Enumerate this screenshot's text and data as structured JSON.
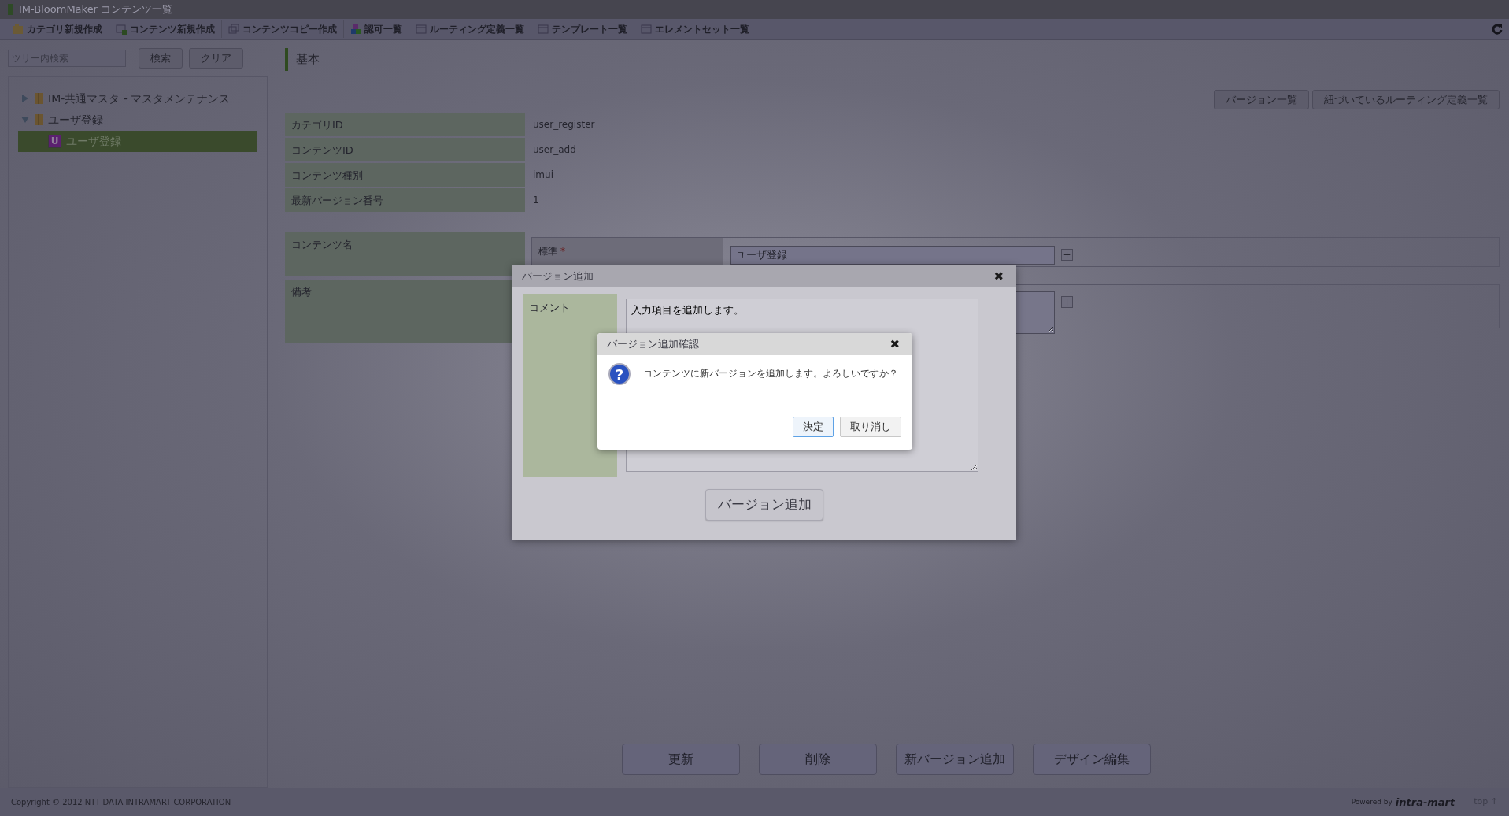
{
  "window": {
    "title": "IM-BloomMaker コンテンツ一覧"
  },
  "toolbar": [
    {
      "label": "カテゴリ新規作成",
      "kind": "folder"
    },
    {
      "label": "コンテンツ新規作成",
      "kind": "new"
    },
    {
      "label": "コンテンツコピー作成",
      "kind": "copy"
    },
    {
      "label": "認可一覧",
      "kind": "blocks"
    },
    {
      "label": "ルーティング定義一覧",
      "kind": "table"
    },
    {
      "label": "テンプレート一覧",
      "kind": "table"
    },
    {
      "label": "エレメントセット一覧",
      "kind": "table"
    }
  ],
  "tree_search": {
    "placeholder": "ツリー内検索",
    "buttons": [
      "検索",
      "クリア"
    ]
  },
  "tree": [
    {
      "label": "IM-共通マスタ - マスタメンテナンス",
      "kind": "folder",
      "expanded": false,
      "selected": false
    },
    {
      "label": "ユーザ登録",
      "kind": "folder",
      "expanded": true,
      "selected": false,
      "children": [
        {
          "label": "ユーザ登録",
          "kind": "content",
          "badge": "U",
          "selected": true
        }
      ]
    }
  ],
  "section_title": "基本",
  "header_buttons": [
    "バージョン一覧",
    "紐づいているルーティング定義一覧"
  ],
  "details": [
    {
      "label": "カテゴリID",
      "value": "user_register"
    },
    {
      "label": "コンテンツID",
      "value": "user_add"
    },
    {
      "label": "コンテンツ種別",
      "value": "imui"
    },
    {
      "label": "最新バージョン番号",
      "value": "1"
    }
  ],
  "localized_fields": [
    {
      "label": "コンテンツ名",
      "sub_label": "標準",
      "required_mark": "*",
      "kind": "input",
      "value": "ユーザ登録",
      "add_symbol": "+"
    },
    {
      "label": "備考",
      "kind": "textarea",
      "add_symbol": "+"
    }
  ],
  "action_buttons": [
    "更新",
    "削除",
    "新バージョン追加",
    "デザイン編集"
  ],
  "footer": {
    "copyright": "Copyright © 2012 NTT DATA INTRAMART CORPORATION",
    "powered_by": "Powered by",
    "brand": "intra-mart",
    "top_link": "top ↑"
  },
  "version_dialog": {
    "title": "バージョン追加",
    "close": "✖",
    "comment_label": "コメント",
    "comment": "入力項目を追加します。",
    "submit": "バージョン追加"
  },
  "confirm_dialog": {
    "title": "バージョン追加確認",
    "close": "✖",
    "icon": "?",
    "message": "コンテンツに新バージョンを追加します。よろしいですか？",
    "buttons": [
      {
        "label": "決定",
        "focused": true
      },
      {
        "label": "取り消し",
        "focused": false
      }
    ]
  }
}
